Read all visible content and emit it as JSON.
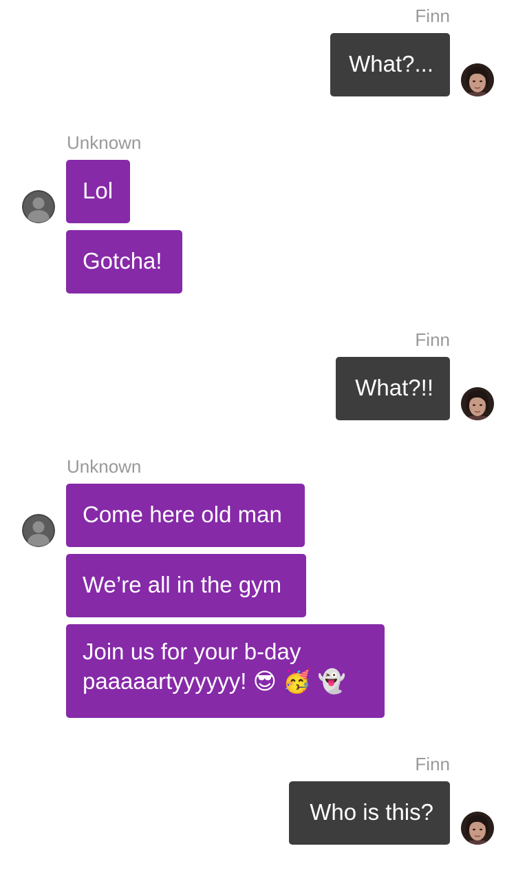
{
  "conversation": {
    "groups": [
      {
        "sender": "Finn",
        "messages": [
          "What?..."
        ]
      },
      {
        "sender": "Unknown",
        "messages": [
          "Lol",
          "Gotcha!"
        ]
      },
      {
        "sender": "Finn",
        "messages": [
          "What?!!"
        ]
      },
      {
        "sender": "Unknown",
        "messages": [
          "Come here old man",
          "We’re all in the gym",
          "Join us for your b-day paaaaartyyyyyy! 😎 🥳 👻"
        ]
      },
      {
        "sender": "Finn",
        "messages": [
          "Who is this?"
        ]
      }
    ]
  },
  "colors": {
    "outgoing_bubble": "#3d3d3d",
    "incoming_bubble": "#862aa8",
    "sender_name": "#999999",
    "background": "#ffffff"
  },
  "icons": {
    "finn_avatar": "user-photo-avatar",
    "unknown_avatar": "default-person-avatar"
  }
}
